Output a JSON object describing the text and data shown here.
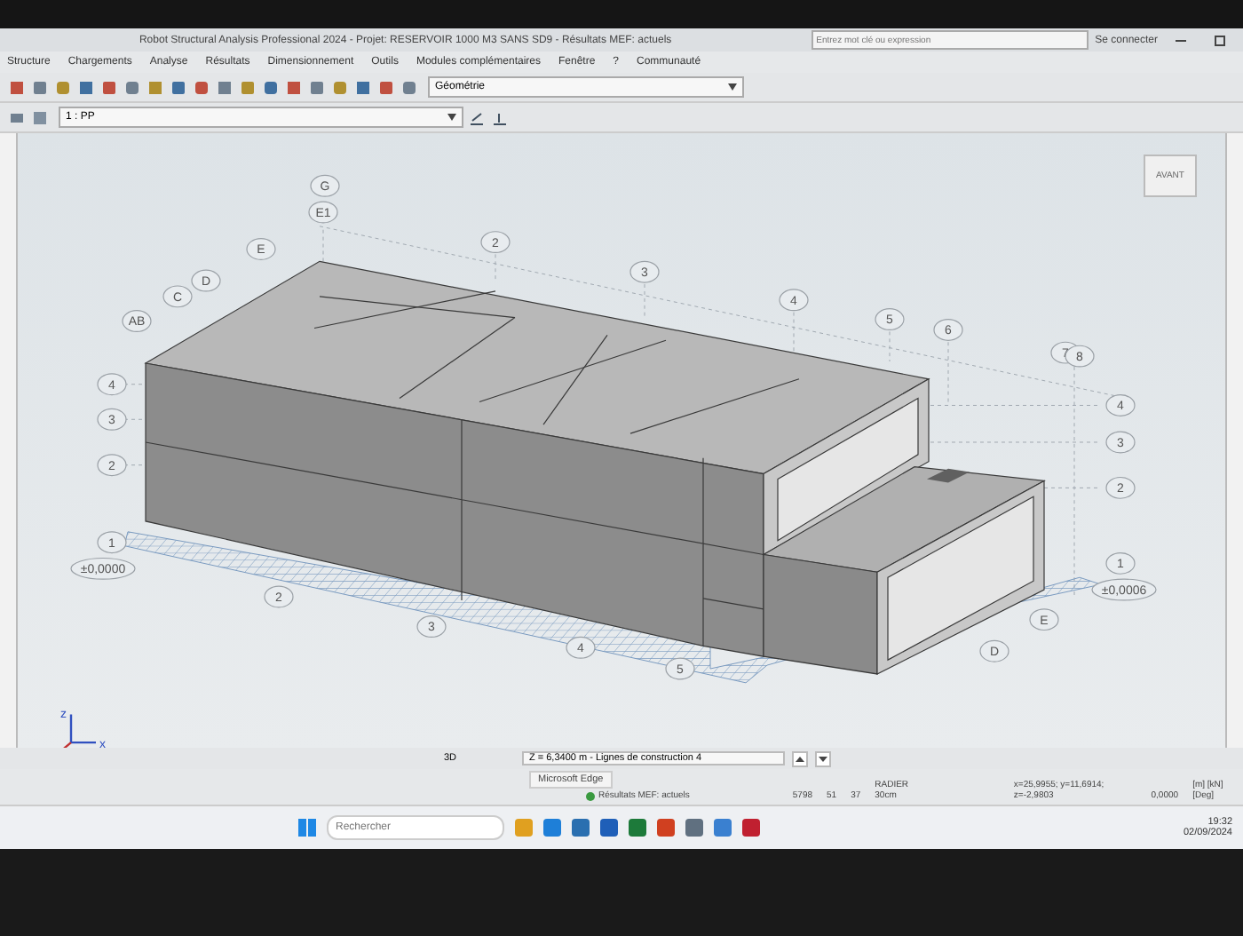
{
  "window": {
    "title": "Robot Structural Analysis Professional 2024 - Projet: RESERVOIR 1000 M3 SANS SD9 - Résultats MEF: actuels",
    "search": {
      "placeholder": "Entrez mot clé ou expression"
    },
    "sign_in": "Se connecter"
  },
  "menu": [
    "Structure",
    "Chargements",
    "Analyse",
    "Résultats",
    "Dimensionnement",
    "Outils",
    "Modules complémentaires",
    "Fenêtre",
    "?",
    "Communauté"
  ],
  "toolbar": {
    "view_dropdown": "Géométrie",
    "case_dropdown": "1 : PP"
  },
  "viewport": {
    "view_cube": "AVANT",
    "axis_labels": [
      "z",
      "x"
    ],
    "grid_labels": [
      "G",
      "E1",
      "E",
      "D",
      "C",
      "AB",
      "2",
      "3",
      "4",
      "5",
      "6",
      "7",
      "8",
      "4",
      "3",
      "2",
      "1",
      "±0,0000",
      "4",
      "3",
      "2",
      "1",
      "±0,0006",
      "2",
      "3",
      "4",
      "5",
      "E",
      "D"
    ]
  },
  "view_bar": {
    "view": "3D",
    "plane": "Z = 6,3400 m - Lignes de construction 4"
  },
  "tooltip": "Microsoft Edge",
  "status_bar": {
    "results": "Résultats MEF: actuels",
    "fields": [
      "5798",
      "51",
      "37",
      "RADIER 30cm"
    ],
    "coordinates": "x=25,9955; y=11,6914; z=-2,9803",
    "angle": "0,0000",
    "units": "[m] [kN] [Deg]"
  },
  "taskbar": {
    "search": {
      "placeholder": "Rechercher"
    },
    "time": "19:32",
    "date": "02/09/2024"
  }
}
